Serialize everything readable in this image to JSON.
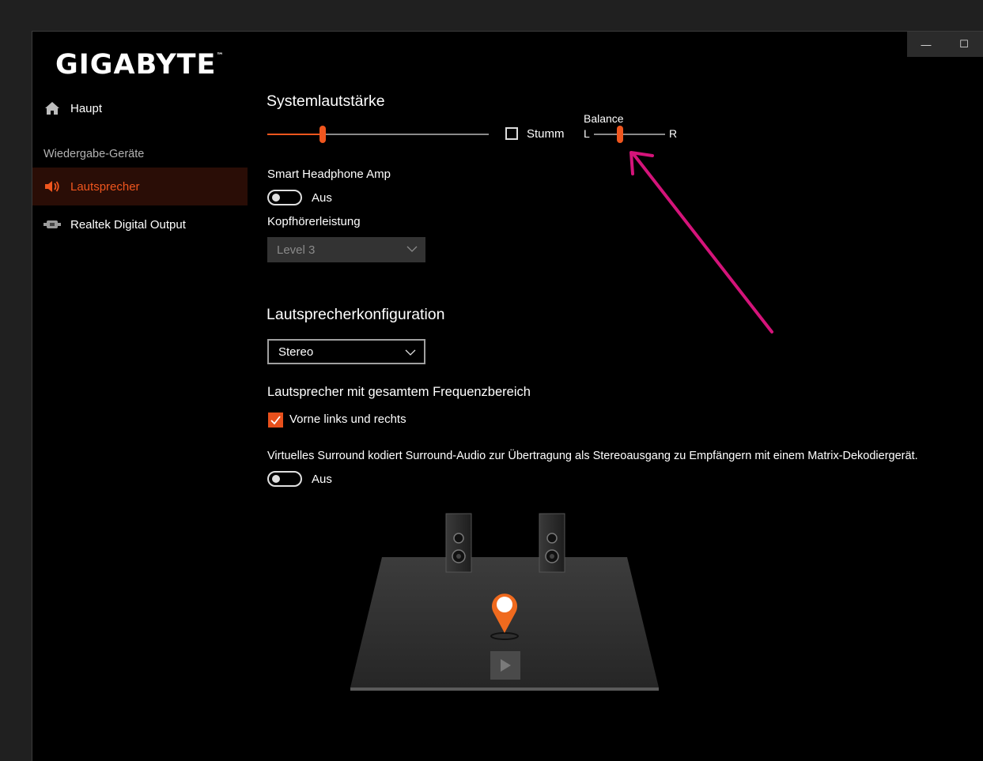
{
  "app": {
    "brand": "GIGABYTE",
    "trademark": "™",
    "minimize_glyph": "—",
    "maximize_glyph": "☐"
  },
  "nav": {
    "home": "Haupt",
    "section": "Wiedergabe-Geräte",
    "items": [
      {
        "label": "Lautsprecher",
        "active": true
      },
      {
        "label": "Realtek Digital Output",
        "active": false
      }
    ]
  },
  "volume": {
    "title": "Systemlautstärke",
    "level": 0.25,
    "mute_label": "Stumm",
    "mute_checked": false,
    "balance_label": "Balance",
    "balance_left": "L",
    "balance_right": "R",
    "balance_level": 0.37
  },
  "headphone": {
    "amp_label": "Smart Headphone Amp",
    "amp_state": "Aus",
    "power_label": "Kopfhörerleistung",
    "power_value": "Level 3"
  },
  "speaker_config": {
    "title": "Lautsprecherkonfiguration",
    "value": "Stereo",
    "fullrange_title": "Lautsprecher mit gesamtem Frequenzbereich",
    "front_label": "Vorne links und rechts",
    "front_checked": true,
    "surround_desc": "Virtuelles Surround kodiert Surround-Audio zur Übertragung als Stereoausgang zu Empfängern mit einem Matrix-Dekodiergerät.",
    "surround_state": "Aus"
  },
  "colors": {
    "accent": "#f0561e",
    "annotation": "#d4147a"
  }
}
